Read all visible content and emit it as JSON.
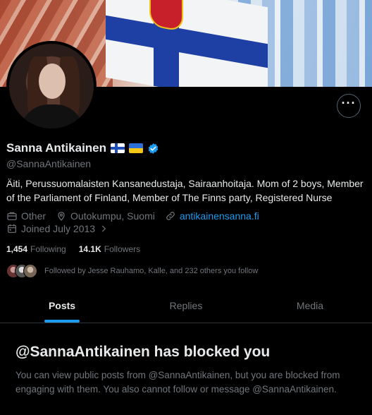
{
  "profile": {
    "name": "Sanna Antikainen",
    "handle": "@SannaAntikainen",
    "bio": "Äiti, Perussuomalaisten Kansanedustaja, Sairaanhoitaja. Mom of 2 boys, Member of the Parliament of Finland, Member of The Finns party, Registered Nurse",
    "category": "Other",
    "location": "Outokumpu, Suomi",
    "website": "antikainensanna.fi",
    "joined": "Joined July 2013",
    "following_count": "1,454",
    "following_label": "Following",
    "followers_count": "14.1K",
    "followers_label": "Followers",
    "followed_by": "Followed by Jesse Rauhamo, Kalle, and 232 others you follow"
  },
  "tabs": [
    {
      "label": "Posts",
      "active": true
    },
    {
      "label": "Replies",
      "active": false
    },
    {
      "label": "Media",
      "active": false
    }
  ],
  "blocked": {
    "title": "@SannaAntikainen has blocked you",
    "message": "You can view public posts from @SannaAntikainen, but you are blocked from engaging with them. You also cannot follow or message @SannaAntikainen."
  },
  "colors": {
    "accent": "#1d9bf0",
    "background": "#000000",
    "text_primary": "#e7e9ea",
    "text_secondary": "#71767b"
  },
  "icons": [
    "more-icon",
    "finland-flag-icon",
    "ukraine-flag-icon",
    "verified-badge-icon",
    "briefcase-icon",
    "location-pin-icon",
    "link-icon",
    "calendar-icon",
    "chevron-right-icon"
  ]
}
